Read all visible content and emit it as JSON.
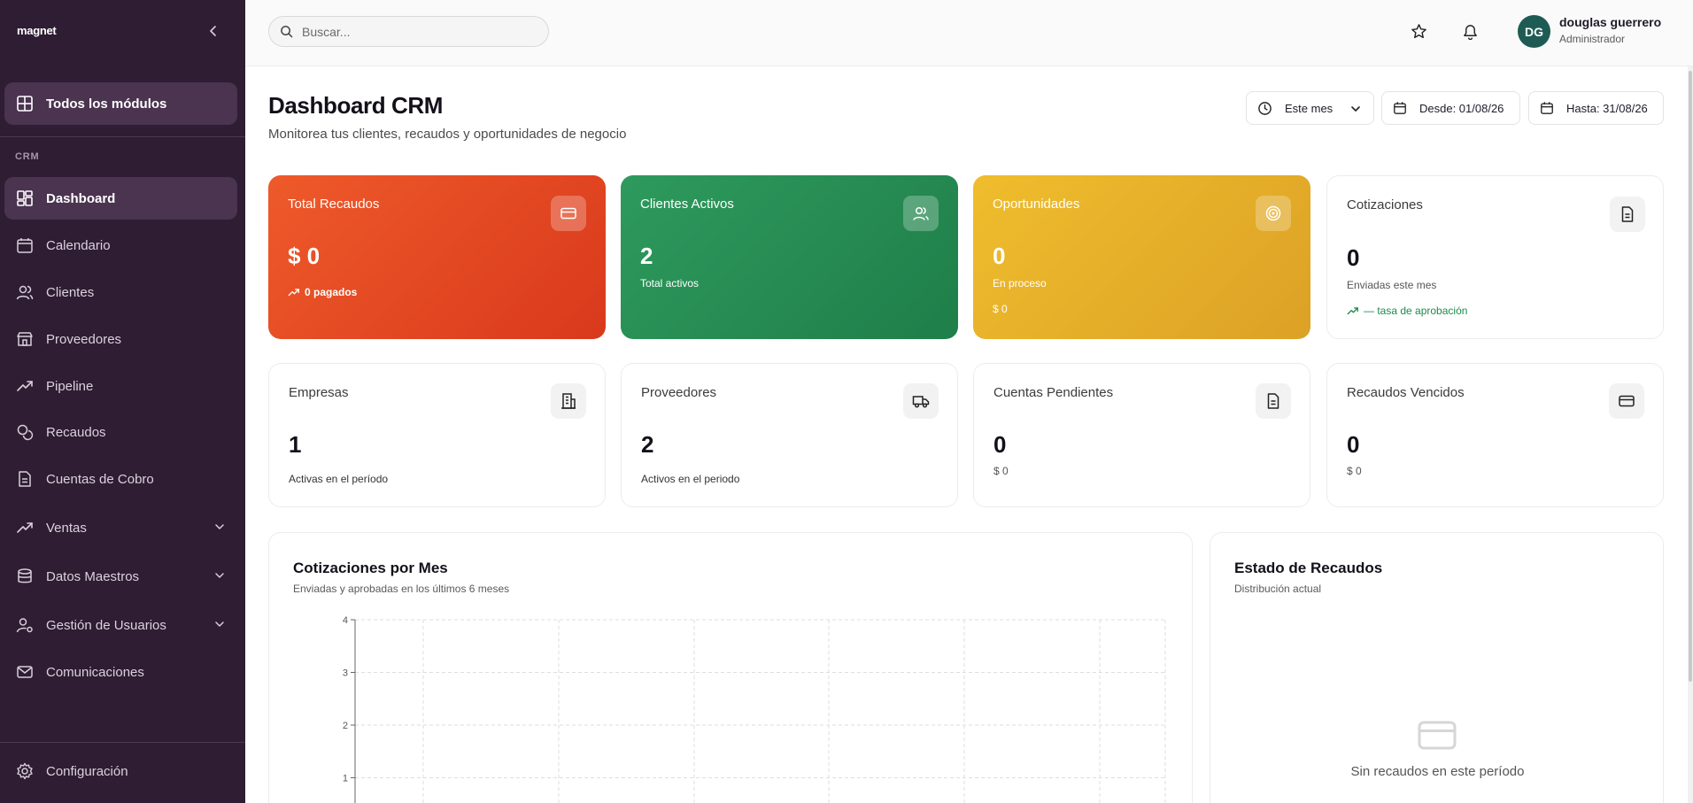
{
  "sidebar": {
    "brand": "magnet",
    "all_modules": "Todos los módulos",
    "section": "CRM",
    "items": [
      {
        "label": "Dashboard",
        "icon": "dashboard-icon"
      },
      {
        "label": "Calendario",
        "icon": "calendar-icon"
      },
      {
        "label": "Clientes",
        "icon": "users-icon"
      },
      {
        "label": "Proveedores",
        "icon": "store-icon"
      },
      {
        "label": "Pipeline",
        "icon": "trend-icon"
      },
      {
        "label": "Recaudos",
        "icon": "coins-icon"
      },
      {
        "label": "Cuentas de Cobro",
        "icon": "document-icon"
      },
      {
        "label": "Ventas",
        "icon": "trend-icon"
      },
      {
        "label": "Datos Maestros",
        "icon": "database-icon"
      },
      {
        "label": "Gestión de Usuarios",
        "icon": "user-cog-icon"
      },
      {
        "label": "Comunicaciones",
        "icon": "mail-icon"
      }
    ],
    "settings": "Configuración"
  },
  "header": {
    "search_placeholder": "Buscar...",
    "user": {
      "initials": "DG",
      "name": "douglas guerrero",
      "role": "Administrador"
    }
  },
  "page": {
    "title": "Dashboard CRM",
    "subtitle": "Monitorea tus clientes, recaudos y oportunidades de negocio",
    "filters": {
      "period": "Este mes",
      "from": "Desde: 01/08/26",
      "to": "Hasta: 31/08/26"
    }
  },
  "cards_top": [
    {
      "title": "Total Recaudos",
      "value": "$ 0",
      "sub": "0 pagados"
    },
    {
      "title": "Clientes Activos",
      "value": "2",
      "sub": "Total activos"
    },
    {
      "title": "Oportunidades",
      "value": "0",
      "sub": "En proceso",
      "sub2": "$ 0"
    },
    {
      "title": "Cotizaciones",
      "value": "0",
      "sub": "Enviadas este mes",
      "sub2": "— tasa de aprobación"
    }
  ],
  "cards_bottom": [
    {
      "title": "Empresas",
      "value": "1",
      "sub": "Activas en el período"
    },
    {
      "title": "Proveedores",
      "value": "2",
      "sub": "Activos en el periodo"
    },
    {
      "title": "Cuentas Pendientes",
      "value": "0",
      "sub": "$ 0"
    },
    {
      "title": "Recaudos Vencidos",
      "value": "0",
      "sub": "$ 0"
    }
  ],
  "chart_panel": {
    "title": "Cotizaciones por Mes",
    "subtitle": "Enviadas y aprobadas en los últimos 6 meses"
  },
  "chart_data": {
    "type": "bar",
    "title": "Cotizaciones por Mes",
    "ylim": [
      0,
      4
    ],
    "yticks": [
      "4",
      "3",
      "2",
      "1"
    ],
    "grid": true
  },
  "status_panel": {
    "title": "Estado de Recaudos",
    "subtitle": "Distribución actual",
    "empty": "Sin recaudos en este período"
  },
  "colors": {
    "sidebar_bg": "#2e1d33",
    "red": "#e54a24",
    "green": "#268c52",
    "yellow": "#e6af29",
    "avatar": "#1f5b55",
    "positive": "#1e8a4c"
  }
}
